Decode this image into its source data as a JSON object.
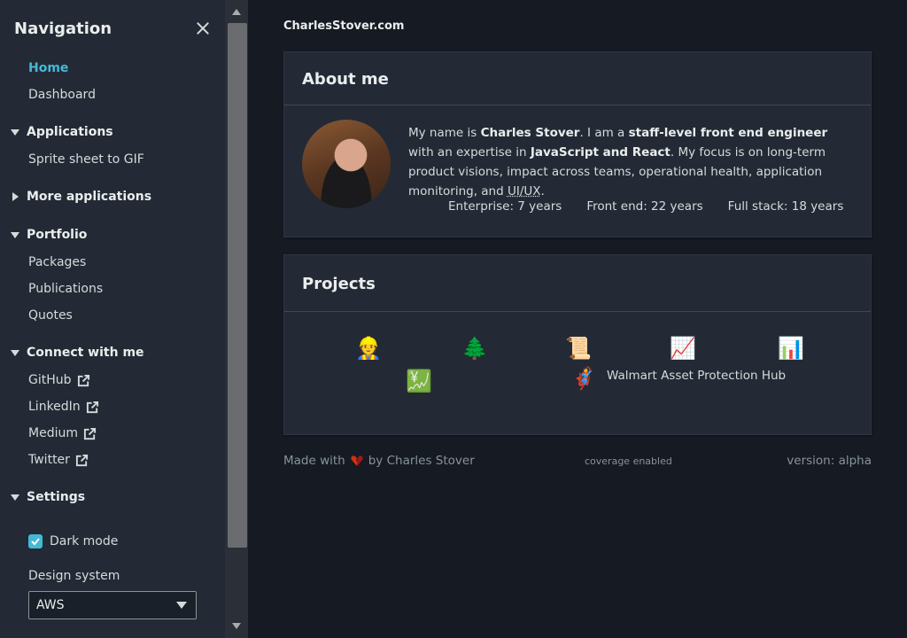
{
  "sidebar": {
    "title": "Navigation",
    "home": "Home",
    "dashboard": "Dashboard",
    "applications": {
      "label": "Applications",
      "items": [
        "Sprite sheet to GIF"
      ]
    },
    "more_applications": "More applications",
    "portfolio": {
      "label": "Portfolio",
      "items": [
        "Packages",
        "Publications",
        "Quotes"
      ]
    },
    "connect": {
      "label": "Connect with me",
      "items": [
        "GitHub",
        "LinkedIn",
        "Medium",
        "Twitter"
      ]
    },
    "settings": {
      "label": "Settings",
      "dark_mode": "Dark mode",
      "dark_mode_checked": true,
      "design_system_label": "Design system",
      "design_system_value": "AWS"
    }
  },
  "main": {
    "site_name": "CharlesStover.com",
    "about": {
      "title": "About me",
      "text_1": "My name is ",
      "name": "Charles Stover",
      "text_2": ". I am a ",
      "role": "staff-level front end engineer",
      "text_3": " with an expertise in ",
      "skills": "JavaScript and React",
      "text_4": ". My focus is on long-term product visions, impact across teams, operational health, application monitoring, and ",
      "uiux": "UI/UX",
      "text_5": ".",
      "stats": [
        "Enterprise: 7 years",
        "Front end: 22 years",
        "Full stack: 18 years"
      ]
    },
    "projects": {
      "title": "Projects",
      "icons": [
        "construction-worker-emoji",
        "evergreen-tree-emoji",
        "scroll-emoji",
        "chart-increasing-emoji",
        "bar-chart-emoji",
        "chart-yen-emoji",
        "superhero-emoji"
      ],
      "featured_label": "Walmart Asset Protection Hub"
    }
  },
  "footer": {
    "made_with": "Made with",
    "by": "by Charles Stover",
    "coverage": "coverage enabled",
    "version": "version: alpha"
  },
  "colors": {
    "accent": "#44b9d6",
    "background": "#161a22",
    "panel": "#232a35",
    "heart": "#d13212"
  }
}
